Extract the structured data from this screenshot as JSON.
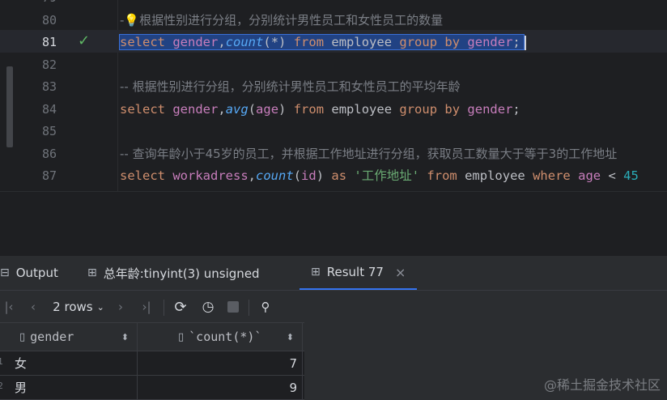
{
  "editor": {
    "lines": [
      {
        "num": "80",
        "text": "-- 根据性别进行分组，分别统计男性员工和女性员工的数量"
      },
      {
        "num": "81",
        "status": "check",
        "tokens": {
          "select": "select",
          "gender": "gender",
          "comma": ",",
          "fn": "count",
          "args": "(*)",
          "from": "from",
          "table": "employee",
          "group": "group",
          "by": "by",
          "gender2": "gender",
          "semi": ";"
        }
      },
      {
        "num": "82"
      },
      {
        "num": "83",
        "text": "-- 根据性别进行分组，分别统计男性员工和女性员工的平均年龄"
      },
      {
        "num": "84",
        "tokens": {
          "select": "select",
          "gender": "gender",
          "comma": ",",
          "fn": "avg",
          "open": "(",
          "arg": "age",
          "close": ")",
          "from": "from",
          "table": "employee",
          "group": "group",
          "by": "by",
          "gender2": "gender",
          "semi": ";"
        }
      },
      {
        "num": "85"
      },
      {
        "num": "86",
        "text": "-- 查询年龄小于45岁的员工，并根据工作地址进行分组，获取员工数量大于等于3的工作地址"
      },
      {
        "num": "87",
        "tokens": {
          "select": "select",
          "col": "workadress",
          "comma": ",",
          "fn": "count",
          "open": "(",
          "arg": "id",
          "close": ")",
          "as": "as",
          "alias": "'工作地址'",
          "from": "from",
          "table": "employee",
          "where": "where",
          "age": "age",
          "lt": "<",
          "num": "45"
        }
      }
    ]
  },
  "panel": {
    "tabs": [
      {
        "label": "Output"
      },
      {
        "label": "总年龄:tinyint(3) unsigned"
      },
      {
        "label": "Result 77"
      }
    ],
    "toolbar": {
      "rows_label": "2 rows",
      "icons": [
        "first-page-icon",
        "prev-page-icon",
        "next-page-icon",
        "last-page-icon",
        "refresh-icon",
        "history-icon",
        "stop-icon",
        "pin-icon"
      ]
    },
    "grid": {
      "columns": [
        "gender",
        "`count(*)`"
      ],
      "rows": [
        {
          "n": "1",
          "gender": "女",
          "count": "7"
        },
        {
          "n": "2",
          "gender": "男",
          "count": "9"
        }
      ]
    }
  },
  "watermark": "@稀土掘金技术社区",
  "colors": {
    "background": "#1e1f22",
    "panel": "#2b2d30",
    "selection": "#214283",
    "keyword": "#cf8e6d",
    "function": "#56a8f5",
    "identifier": "#c77dbb",
    "string": "#6aab73",
    "number": "#2aacb8",
    "check": "#5fb865",
    "accent": "#3574f0"
  }
}
